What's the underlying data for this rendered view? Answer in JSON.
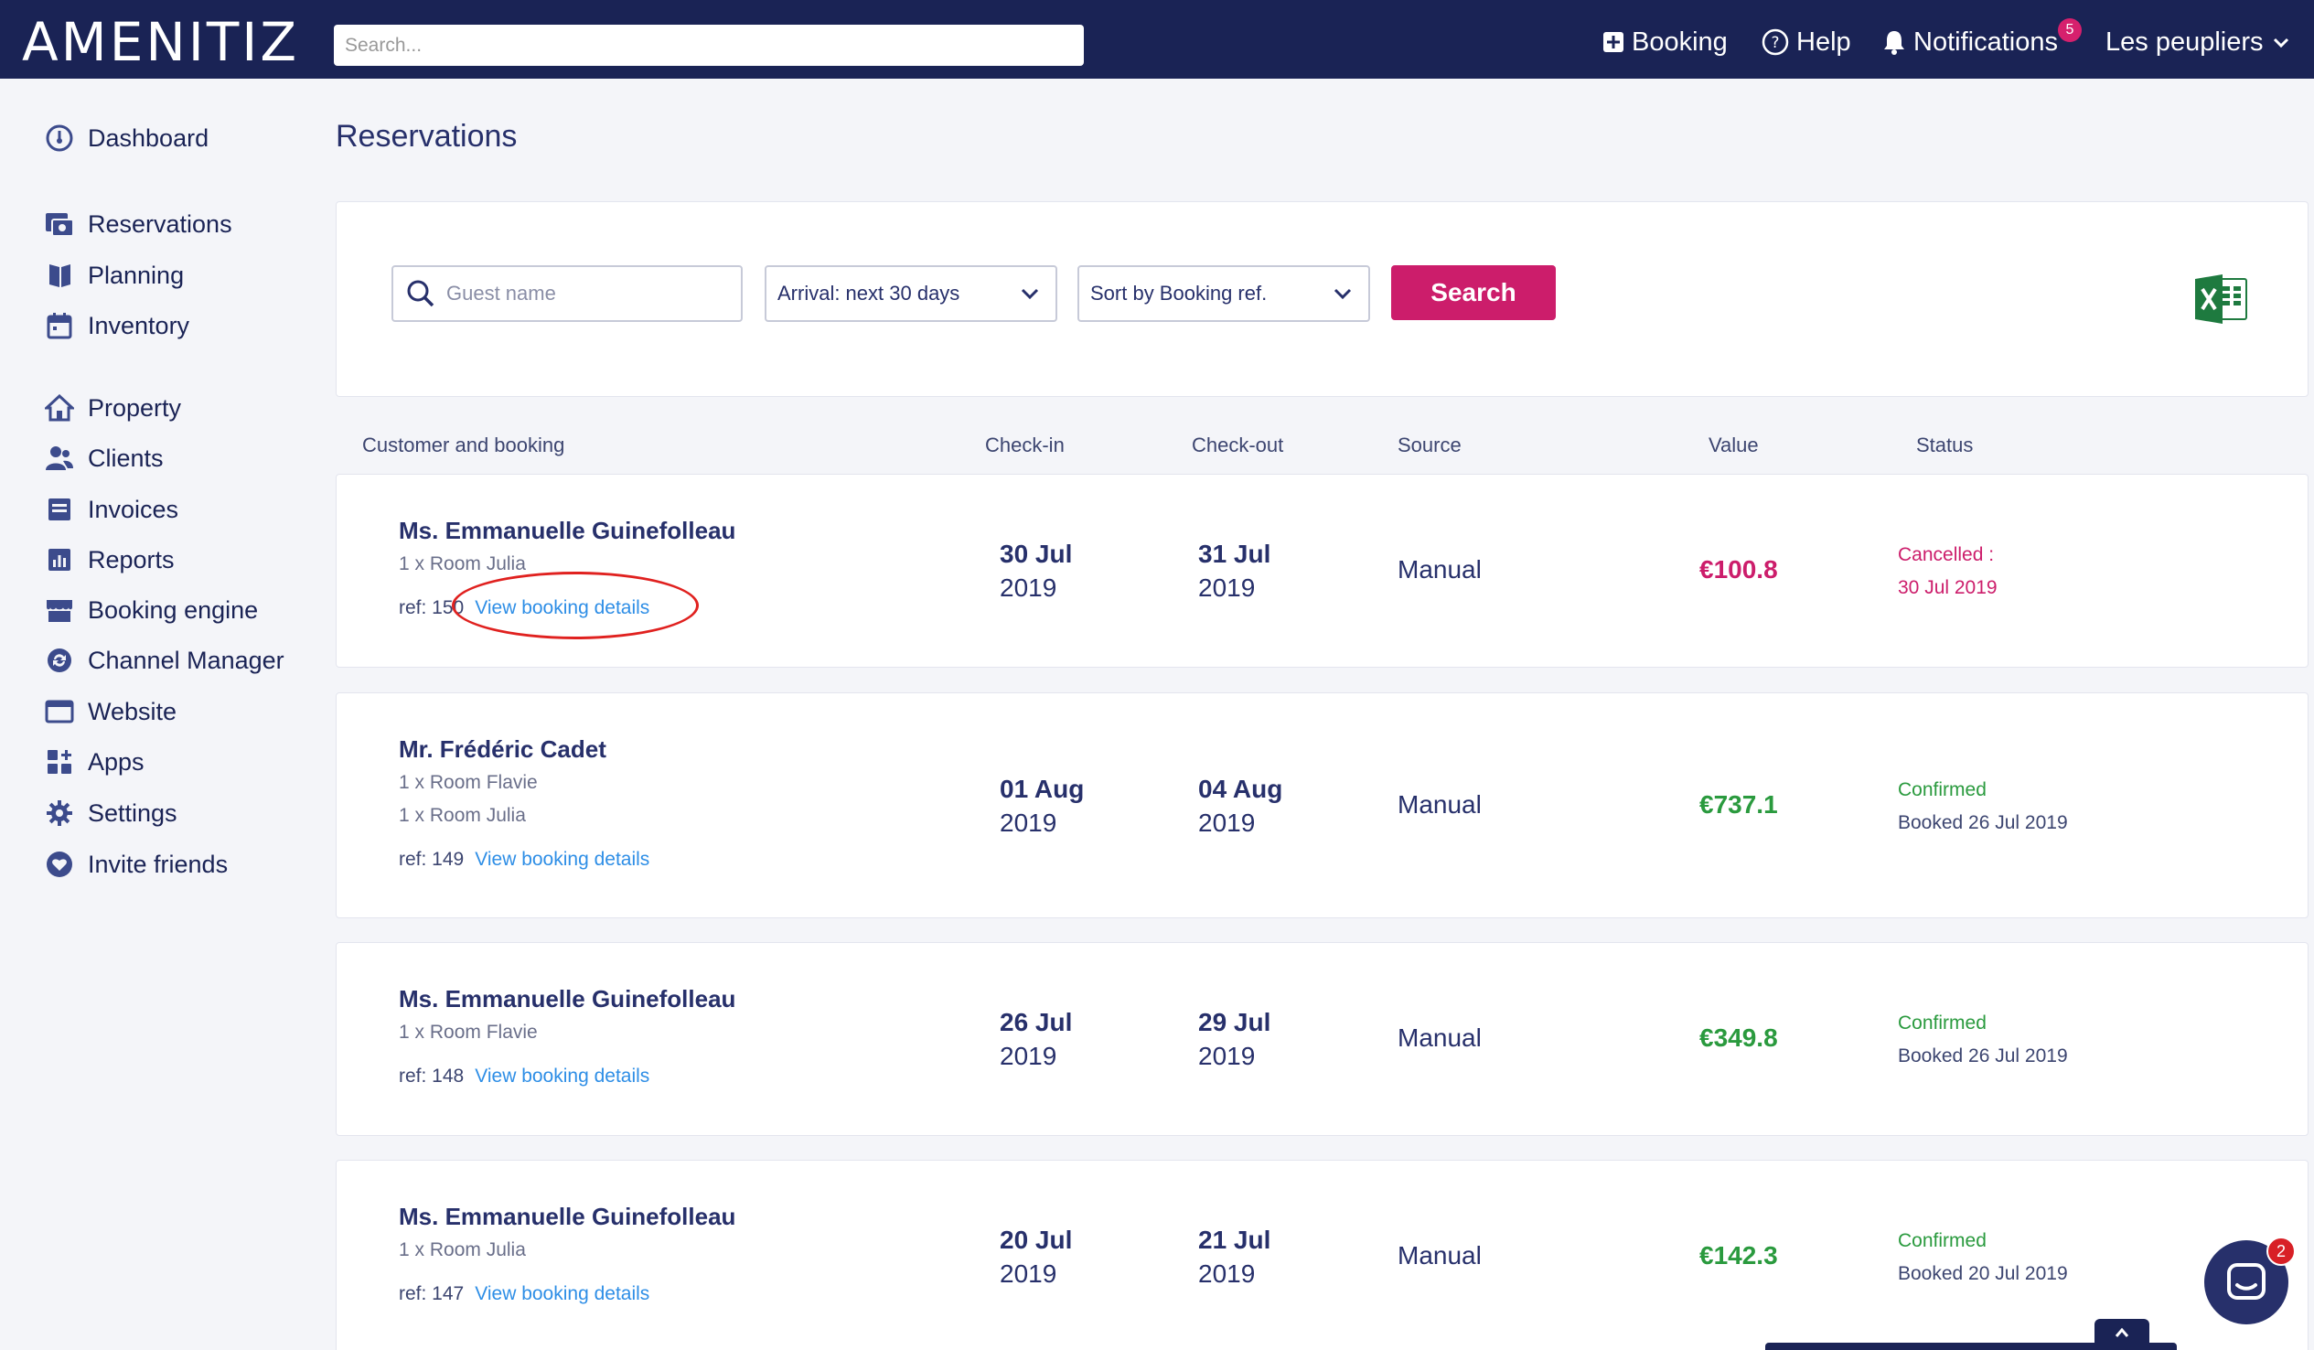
{
  "brand": {
    "logo": "AMENITIZ"
  },
  "topbar": {
    "search_placeholder": "Search...",
    "booking_label": "Booking",
    "help_label": "Help",
    "notifications_label": "Notifications",
    "notifications_count": "5",
    "property_name": "Les peupliers"
  },
  "sidebar": {
    "items": [
      {
        "label": "Dashboard",
        "icon": "dashboard-icon"
      },
      {
        "label": "Reservations",
        "icon": "reservations-icon"
      },
      {
        "label": "Planning",
        "icon": "planning-icon"
      },
      {
        "label": "Inventory",
        "icon": "calendar-icon"
      },
      {
        "label": "Property",
        "icon": "home-icon"
      },
      {
        "label": "Clients",
        "icon": "users-icon"
      },
      {
        "label": "Invoices",
        "icon": "invoice-icon"
      },
      {
        "label": "Reports",
        "icon": "bar-chart-icon"
      },
      {
        "label": "Booking engine",
        "icon": "storefront-icon"
      },
      {
        "label": "Channel Manager",
        "icon": "sync-icon"
      },
      {
        "label": "Website",
        "icon": "browser-window-icon"
      },
      {
        "label": "Apps",
        "icon": "apps-grid-icon"
      },
      {
        "label": "Settings",
        "icon": "gear-icon"
      },
      {
        "label": "Invite friends",
        "icon": "heart-icon"
      }
    ]
  },
  "page": {
    "title": "Reservations"
  },
  "filters": {
    "guest_placeholder": "Guest name",
    "arrival_value": "Arrival: next 30 days",
    "sort_value": "Sort by Booking ref.",
    "search_label": "Search"
  },
  "columns": {
    "customer": "Customer and booking",
    "checkin": "Check-in",
    "checkout": "Check-out",
    "source": "Source",
    "value": "Value",
    "status": "Status"
  },
  "bookings": [
    {
      "name": "Ms. Emmanuelle Guinefolleau",
      "rooms": [
        "1 x Room Julia"
      ],
      "ref": "ref: 150",
      "link": "View booking details",
      "checkin_day": "30 Jul",
      "checkin_year": "2019",
      "checkout_day": "31 Jul",
      "checkout_year": "2019",
      "source": "Manual",
      "value": "€100.8",
      "status_line1": "Cancelled :",
      "status_line2": "30 Jul 2019",
      "status_color": "#cc1d6b"
    },
    {
      "name": "Mr. Frédéric Cadet",
      "rooms": [
        "1 x Room Flavie",
        "1 x Room Julia"
      ],
      "ref": "ref: 149",
      "link": "View booking details",
      "checkin_day": "01 Aug",
      "checkin_year": "2019",
      "checkout_day": "04 Aug",
      "checkout_year": "2019",
      "source": "Manual",
      "value": "€737.1",
      "status_line1": "Confirmed",
      "status_line2": "Booked 26 Jul 2019",
      "status_color": "#2a9a3e"
    },
    {
      "name": "Ms. Emmanuelle Guinefolleau",
      "rooms": [
        "1 x Room Flavie"
      ],
      "ref": "ref: 148",
      "link": "View booking details",
      "checkin_day": "26 Jul",
      "checkin_year": "2019",
      "checkout_day": "29 Jul",
      "checkout_year": "2019",
      "source": "Manual",
      "value": "€349.8",
      "status_line1": "Confirmed",
      "status_line2": "Booked 26 Jul 2019",
      "status_color": "#2a9a3e"
    },
    {
      "name": "Ms. Emmanuelle Guinefolleau",
      "rooms": [
        "1 x Room Julia"
      ],
      "ref": "ref: 147",
      "link": "View booking details",
      "checkin_day": "20 Jul",
      "checkin_year": "2019",
      "checkout_day": "21 Jul",
      "checkout_year": "2019",
      "source": "Manual",
      "value": "€142.3",
      "status_line1": "Confirmed",
      "status_line2": "Booked 20 Jul 2019",
      "status_color": "#2a9a3e"
    }
  ],
  "chat": {
    "unread": "2"
  },
  "colors": {
    "navy": "#1a2355",
    "accent": "#cc1d6b",
    "link": "#2e8ee6",
    "confirmed": "#2a9a3e"
  }
}
